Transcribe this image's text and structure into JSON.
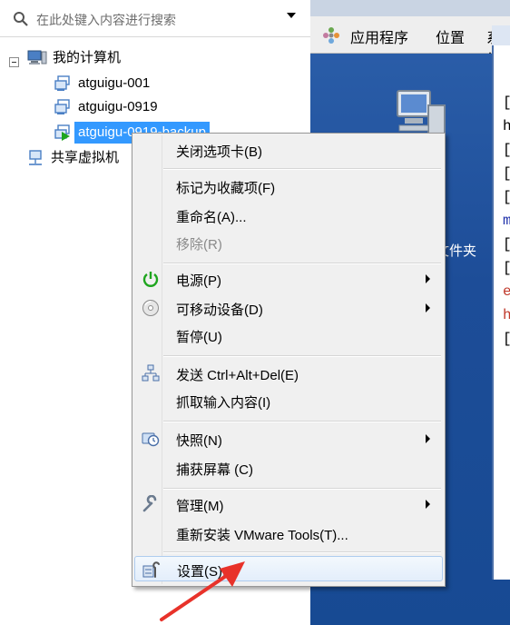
{
  "search": {
    "placeholder": "在此处键入内容进行搜索"
  },
  "tree": {
    "root_label": "我的计算机",
    "vms": [
      {
        "label": "atguigu-001"
      },
      {
        "label": "atguigu-0919"
      },
      {
        "label": "atguigu-0919-backup",
        "selected": true,
        "running": true
      }
    ],
    "shared_label": "共享虚拟机"
  },
  "vm_screen": {
    "menubar": [
      "应用程序",
      "位置",
      "系统"
    ],
    "folder_label_fragment": "文件夹",
    "terminal_chars": [
      "[",
      "h",
      "[",
      "[",
      "[",
      "m",
      "[",
      "[",
      "e",
      "h",
      "["
    ]
  },
  "context_menu": {
    "sections": [
      {
        "items": [
          {
            "label": "关闭选项卡(B)"
          }
        ]
      },
      {
        "items": [
          {
            "label": "标记为收藏项(F)"
          },
          {
            "label": "重命名(A)..."
          },
          {
            "label": "移除(R)",
            "disabled": true
          }
        ]
      },
      {
        "items": [
          {
            "label": "电源(P)",
            "icon": "power-icon",
            "submenu": true
          },
          {
            "label": "可移动设备(D)",
            "icon": "removable-device-icon",
            "submenu": true
          },
          {
            "label": "暂停(U)"
          }
        ]
      },
      {
        "items": [
          {
            "label": "发送 Ctrl+Alt+Del(E)",
            "icon": "network-send-icon"
          },
          {
            "label": "抓取输入内容(I)"
          }
        ]
      },
      {
        "items": [
          {
            "label": "快照(N)",
            "icon": "snapshot-icon",
            "submenu": true
          },
          {
            "label": "捕获屏幕 (C)"
          }
        ]
      },
      {
        "items": [
          {
            "label": "管理(M)",
            "icon": "wrench-icon",
            "submenu": true
          },
          {
            "label": "重新安装 VMware Tools(T)..."
          }
        ]
      },
      {
        "items": [
          {
            "label": "设置(S)...",
            "icon": "settings-icon",
            "highlighted": true
          }
        ]
      }
    ]
  },
  "colors": {
    "selection": "#3399ff",
    "menu_bg": "#f0f0f0",
    "annotation_arrow": "#e8322a",
    "vm_desktop": "#1d4d98"
  }
}
